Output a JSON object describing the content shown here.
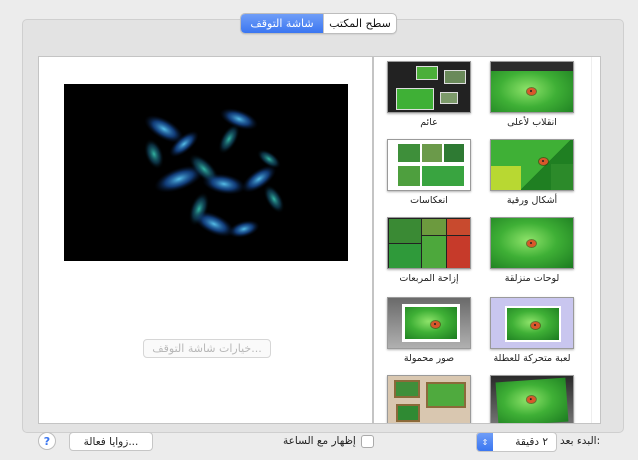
{
  "tabs": {
    "active": "شاشة التوقف",
    "inactive": "سطح المكتب"
  },
  "options_button": "خيارات شاشة التوقف...",
  "thumbnails": [
    {
      "label": "انقلاب لأعلى"
    },
    {
      "label": "عائم"
    },
    {
      "label": "أشكال ورقية"
    },
    {
      "label": "انعكاسات"
    },
    {
      "label": "لوحات منزلقة"
    },
    {
      "label": "إزاحة المربعات"
    },
    {
      "label": "لعبة متحركة للعطلة"
    },
    {
      "label": "صور محمولة"
    }
  ],
  "bottom": {
    "help_symbol": "?",
    "hot_corners": "زوايا فعالة...",
    "show_clock": "إظهار مع الساعة",
    "start_after_label": "البدء بعد:",
    "start_after_value": "٢ دقيقة",
    "select_arrow_icon": "⇕"
  },
  "colors": {
    "accent": "#3a76f1"
  }
}
